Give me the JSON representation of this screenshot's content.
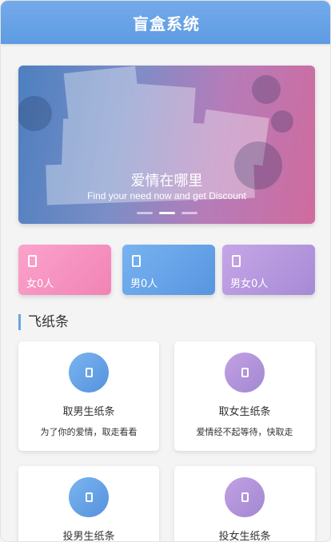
{
  "app": {
    "title": "盲盒系统"
  },
  "banner": {
    "title": "爱情在哪里",
    "subtitle": "Find your need now and get Discount",
    "slides": 3,
    "active_slide": 1
  },
  "stats": [
    {
      "label": "女0人",
      "icon": "note-icon"
    },
    {
      "label": "男0人",
      "icon": "note-icon"
    },
    {
      "label": "男女0人",
      "icon": "note-icon"
    }
  ],
  "section": {
    "title": "飞纸条"
  },
  "cards": [
    {
      "title": "取男生纸条",
      "subtitle": "为了你的爱情，取走看看",
      "icon": "note-icon",
      "color": "#5a97e2"
    },
    {
      "title": "取女生纸条",
      "subtitle": "爱情经不起等待，快取走",
      "icon": "note-icon",
      "color": "#a88ad5"
    },
    {
      "title": "投男生纸条",
      "subtitle": "",
      "icon": "note-icon",
      "color": "#5a97e2"
    },
    {
      "title": "投女生纸条",
      "subtitle": "",
      "icon": "note-icon",
      "color": "#a88ad5"
    }
  ],
  "colors": {
    "header": "#6aa2e6",
    "female": "#f38bbb",
    "male": "#66a3e8",
    "both": "#b497de"
  }
}
